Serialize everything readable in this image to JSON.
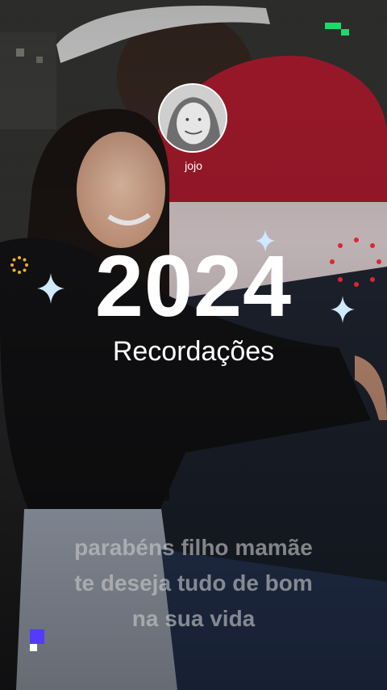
{
  "story": {
    "username": "jojo",
    "year": "2024",
    "subtitle": "Recordações",
    "caption_lines": [
      "parabéns filho mamãe",
      "te deseja tudo de bom",
      "na sua vida"
    ]
  },
  "colors": {
    "accent_green": "#1fd86a",
    "accent_blue": "#4f3cff",
    "jacket_red": "#b81c30"
  },
  "icons": [
    "sparkle-icon",
    "sun-dots-icon",
    "red-dots-icon",
    "green-pixel-logo",
    "blue-pixel-square"
  ]
}
